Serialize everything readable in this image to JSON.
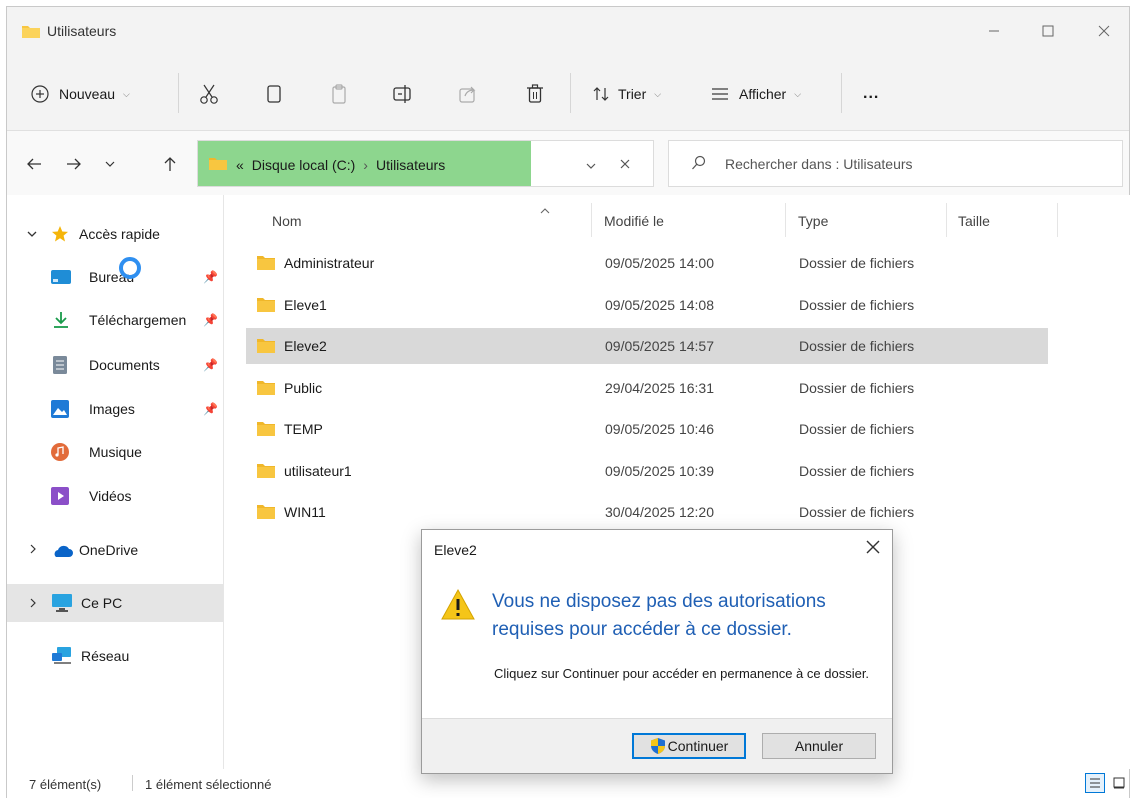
{
  "window": {
    "title": "Utilisateurs"
  },
  "toolbar": {
    "new_label": "Nouveau",
    "sort_label": "Trier",
    "view_label": "Afficher",
    "more_label": "..."
  },
  "address": {
    "overflow": "«",
    "crumbs": [
      "Disque local (C:)",
      "Utilisateurs"
    ],
    "sep": "›"
  },
  "search": {
    "placeholder": "Rechercher dans : Utilisateurs"
  },
  "sidebar": {
    "quick_access": "Accès rapide",
    "items": [
      {
        "label": "Bureau",
        "icon": "desktop-icon",
        "color": "#1f8dd6",
        "pinned": true
      },
      {
        "label": "Téléchargemen",
        "icon": "download-icon",
        "color": "#1a9b4b",
        "pinned": true
      },
      {
        "label": "Documents",
        "icon": "document-icon",
        "color": "#7a8a9a",
        "pinned": true
      },
      {
        "label": "Images",
        "icon": "image-icon",
        "color": "#1f7ad6",
        "pinned": true
      },
      {
        "label": "Musique",
        "icon": "music-icon",
        "color": "#e26b3a",
        "pinned": false
      },
      {
        "label": "Vidéos",
        "icon": "video-icon",
        "color": "#8b4fc8",
        "pinned": false
      }
    ],
    "onedrive": "OneDrive",
    "this_pc": "Ce PC",
    "network": "Réseau"
  },
  "columns": {
    "name": "Nom",
    "modified": "Modifié le",
    "type": "Type",
    "size": "Taille"
  },
  "files": [
    {
      "name": "Administrateur",
      "modified": "09/05/2025 14:00",
      "type": "Dossier de fichiers"
    },
    {
      "name": "Eleve1",
      "modified": "09/05/2025 14:08",
      "type": "Dossier de fichiers"
    },
    {
      "name": "Eleve2",
      "modified": "09/05/2025 14:57",
      "type": "Dossier de fichiers",
      "selected": true
    },
    {
      "name": "Public",
      "modified": "29/04/2025 16:31",
      "type": "Dossier de fichiers"
    },
    {
      "name": "TEMP",
      "modified": "09/05/2025 10:46",
      "type": "Dossier de fichiers"
    },
    {
      "name": "utilisateur1",
      "modified": "09/05/2025 10:39",
      "type": "Dossier de fichiers"
    },
    {
      "name": "WIN11",
      "modified": "30/04/2025 12:20",
      "type": "Dossier de fichiers"
    }
  ],
  "status": {
    "count": "7 élément(s)",
    "selection": "1 élément sélectionné"
  },
  "dialog": {
    "title": "Eleve2",
    "message": "Vous ne disposez pas des autorisations requises pour accéder à ce dossier.",
    "detail": "Cliquez sur Continuer pour accéder en permanence à ce dossier.",
    "continue_label": "Continuer",
    "cancel_label": "Annuler"
  },
  "colors": {
    "accent": "#0078d7",
    "address_highlight": "#8dd68e",
    "folder": "#f8c640",
    "warning": "#f5c518"
  }
}
